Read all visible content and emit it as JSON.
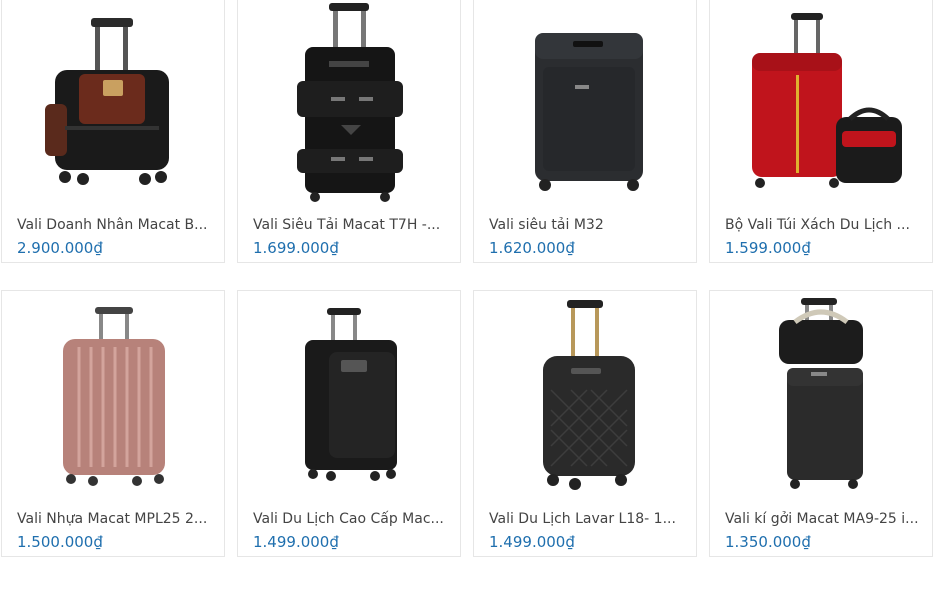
{
  "products": [
    {
      "name": "Vali Doanh Nhân Macat B...",
      "price": "2.900.000₫",
      "image": "black-brown-business-trolley"
    },
    {
      "name": "Vali Siêu Tải Macat T7H -...",
      "price": "1.699.000₫",
      "image": "black-tall-expandable-trolley"
    },
    {
      "name": "Vali siêu tải M32",
      "price": "1.620.000₫",
      "image": "black-soft-trolley"
    },
    {
      "name": "Bộ Vali Túi Xách Du Lịch ...",
      "price": "1.599.000₫",
      "image": "red-trolley-with-bag"
    },
    {
      "name": "Vali Nhựa Macat MPL25 2...",
      "price": "1.500.000₫",
      "image": "rose-gold-hard-trolley"
    },
    {
      "name": "Vali Du Lịch Cao Cấp Mac...",
      "price": "1.499.000₫",
      "image": "black-premium-trolley"
    },
    {
      "name": "Vali Du Lịch Lavar L18- 1...",
      "price": "1.499.000₫",
      "image": "black-quilted-trolley"
    },
    {
      "name": "Vali kí gởi Macat MA9-25 i...",
      "price": "1.350.000₫",
      "image": "black-trolley-with-duffel"
    }
  ]
}
